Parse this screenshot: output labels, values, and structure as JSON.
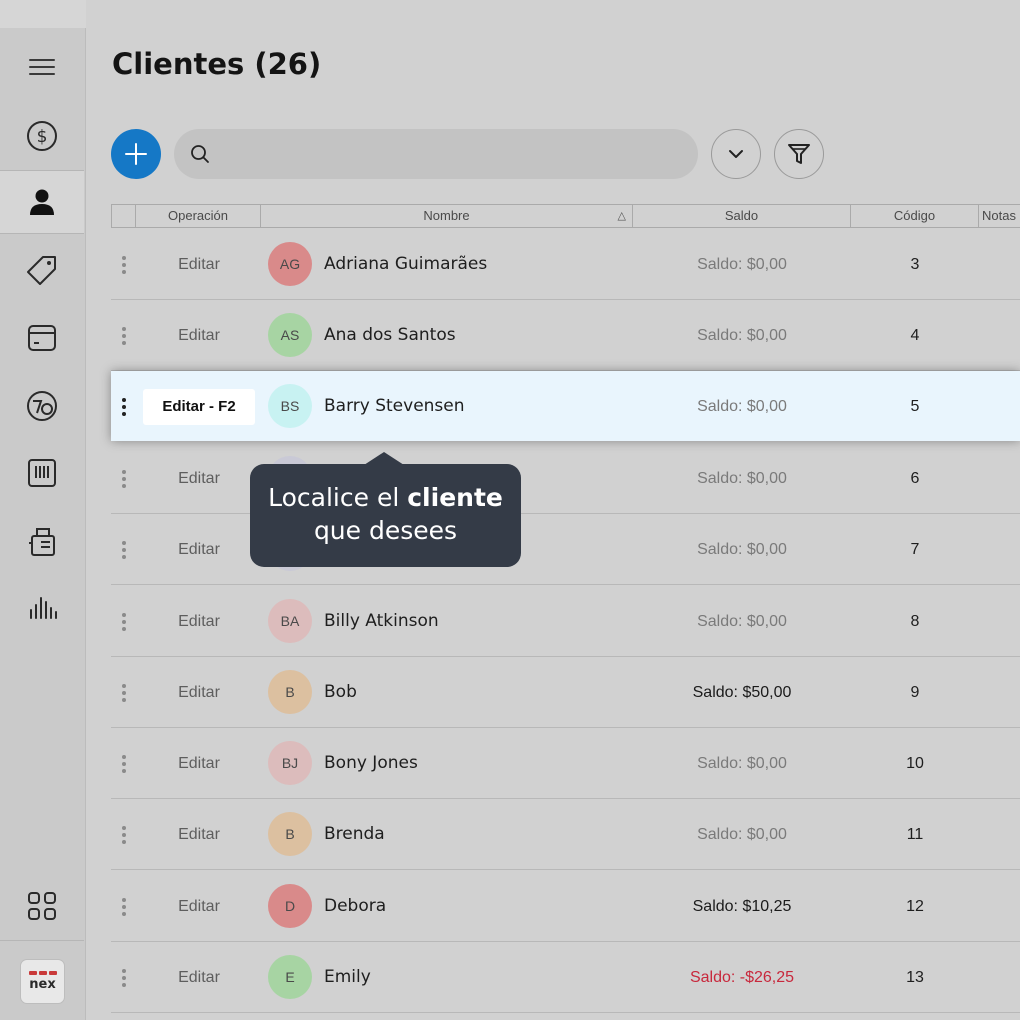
{
  "page": {
    "title": "Clientes (26)"
  },
  "toolbar": {
    "search_placeholder": ""
  },
  "table": {
    "headers": {
      "operacion": "Operación",
      "nombre": "Nombre",
      "saldo": "Saldo",
      "codigo": "Código",
      "notas": "Notas"
    },
    "rows": [
      {
        "edit": "Editar",
        "initials": "AG",
        "name": "Adriana Guimarães",
        "saldo": "Saldo: $0,00",
        "code": "3",
        "avatar_color": "#d98a8a"
      },
      {
        "edit": "Editar",
        "initials": "AS",
        "name": "Ana dos Santos",
        "saldo": "Saldo: $0,00",
        "code": "4",
        "avatar_color": "#a7d4a3"
      },
      {
        "edit": "Editar - F2",
        "initials": "BS",
        "name": "Barry  Stevensen",
        "saldo": "Saldo: $0,00",
        "code": "5",
        "avatar_color": "#c8f2f2"
      },
      {
        "edit": "Editar",
        "initials": "",
        "name": "",
        "saldo": "Saldo: $0,00",
        "code": "6",
        "avatar_color": "#c9c9d6"
      },
      {
        "edit": "Editar",
        "initials": "",
        "name": "",
        "saldo": "Saldo: $0,00",
        "code": "7",
        "avatar_color": "#c9c9d6"
      },
      {
        "edit": "Editar",
        "initials": "BA",
        "name": "Billy Atkinson",
        "saldo": "Saldo: $0,00",
        "code": "8",
        "avatar_color": "#dcbcbc"
      },
      {
        "edit": "Editar",
        "initials": "B",
        "name": "Bob",
        "saldo": "Saldo: $50,00",
        "code": "9",
        "avatar_color": "#dcc0a0"
      },
      {
        "edit": "Editar",
        "initials": "BJ",
        "name": "Bony Jones",
        "saldo": "Saldo: $0,00",
        "code": "10",
        "avatar_color": "#dcbcbc"
      },
      {
        "edit": "Editar",
        "initials": "B",
        "name": "Brenda",
        "saldo": "Saldo: $0,00",
        "code": "11",
        "avatar_color": "#dcc0a0"
      },
      {
        "edit": "Editar",
        "initials": "D",
        "name": "Debora",
        "saldo": "Saldo: $10,25",
        "code": "12",
        "avatar_color": "#d98a8a"
      },
      {
        "edit": "Editar",
        "initials": "E",
        "name": "Emily",
        "saldo": "Saldo: -$26,25",
        "code": "13",
        "avatar_color": "#a7d4a3"
      }
    ]
  },
  "tooltip": {
    "line1_prefix": "Localice el ",
    "line1_bold": "cliente",
    "line2": "que desees"
  },
  "logo": {
    "text": "nex"
  },
  "colors": {
    "accent": "#1578c6",
    "negative": "#c8283c",
    "highlight_row": "#e9f5fd",
    "tooltip_bg": "#343b47"
  },
  "sidebar": {
    "icons": [
      "menu-icon",
      "dollar-icon",
      "user-icon",
      "tag-icon",
      "calendar-icon",
      "dashboard-icon",
      "barcode-icon",
      "register-icon",
      "chart-icon",
      "apps-icon"
    ]
  }
}
